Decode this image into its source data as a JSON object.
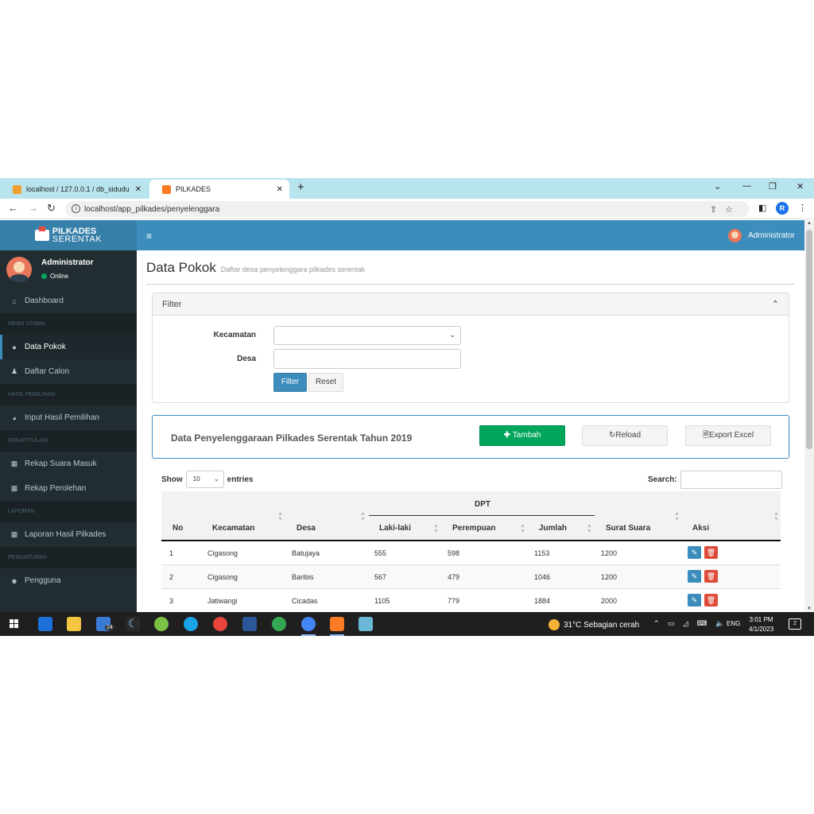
{
  "browser": {
    "tabs": [
      {
        "title": "localhost / 127.0.0.1 / db_sidudu",
        "active": false
      },
      {
        "title": "PILKADES",
        "active": true
      }
    ],
    "url": "localhost/app_pilkades/penyelenggara",
    "profile_initial": "R"
  },
  "sidebar": {
    "logo_line1": "PILKADES",
    "logo_line2": "SERENTAK",
    "user_name": "Administrator",
    "user_status": "Online",
    "items": [
      {
        "type": "item",
        "label": "Dashboard",
        "icon": "home-icon"
      },
      {
        "type": "header",
        "label": "MENU UTAMA"
      },
      {
        "type": "item",
        "label": "Data Pokok",
        "icon": "map-marker-icon",
        "active": true
      },
      {
        "type": "item",
        "label": "Daftar Calon",
        "icon": "male-icon"
      },
      {
        "type": "header",
        "label": "HASIL PEMILIHAN"
      },
      {
        "type": "item",
        "label": "Input Hasil Pemilihan",
        "icon": "pie-chart-icon"
      },
      {
        "type": "header",
        "label": "REKAPITULASI"
      },
      {
        "type": "item",
        "label": "Rekap Suara Masuk",
        "icon": "table-icon"
      },
      {
        "type": "item",
        "label": "Rekap Perolehan",
        "icon": "table-icon"
      },
      {
        "type": "header",
        "label": "LAPORAN"
      },
      {
        "type": "item",
        "label": "Laporan Hasil Pilkades",
        "icon": "table-icon"
      },
      {
        "type": "header",
        "label": "PENGATURAN"
      },
      {
        "type": "item",
        "label": "Pengguna",
        "icon": "users-icon"
      }
    ]
  },
  "topnav": {
    "user": "Administrator"
  },
  "page": {
    "title": "Data Pokok",
    "subtitle": "Daftar desa penyelenggara pilkades serentak"
  },
  "filter": {
    "title": "Filter",
    "kecamatan_label": "Kecamatan",
    "desa_label": "Desa",
    "filter_btn": "Filter",
    "reset_btn": "Reset"
  },
  "databox": {
    "title": "Data Penyelenggaraan Pilkades Serentak Tahun 2019",
    "add_btn": "Tambah",
    "reload_btn": "Reload",
    "export_btn": "Export Excel"
  },
  "table": {
    "show_label": "Show",
    "entries_label": "entries",
    "page_length": "10",
    "search_label": "Search:",
    "group_header": "DPT",
    "columns": [
      "No",
      "Kecamatan",
      "Desa",
      "Laki-laki",
      "Perempuan",
      "Jumlah",
      "Surat Suara",
      "Aksi"
    ],
    "rows": [
      [
        "1",
        "Cigasong",
        "Batujaya",
        "555",
        "598",
        "1153",
        "1200"
      ],
      [
        "2",
        "Cigasong",
        "Baribis",
        "567",
        "479",
        "1046",
        "1200"
      ],
      [
        "3",
        "Jatiwangi",
        "Cicadas",
        "1105",
        "779",
        "1884",
        "2000"
      ]
    ]
  },
  "taskbar": {
    "weather": "31°C  Sebagian cerah",
    "lang": "ENG",
    "time": "3:01 PM",
    "date": "4/1/2023",
    "notifications": "2",
    "mail_badge": "24"
  },
  "colors": {
    "primary": "#3c8dbc",
    "sidebar": "#222d32",
    "success": "#00a65a",
    "danger": "#dd4b39"
  }
}
